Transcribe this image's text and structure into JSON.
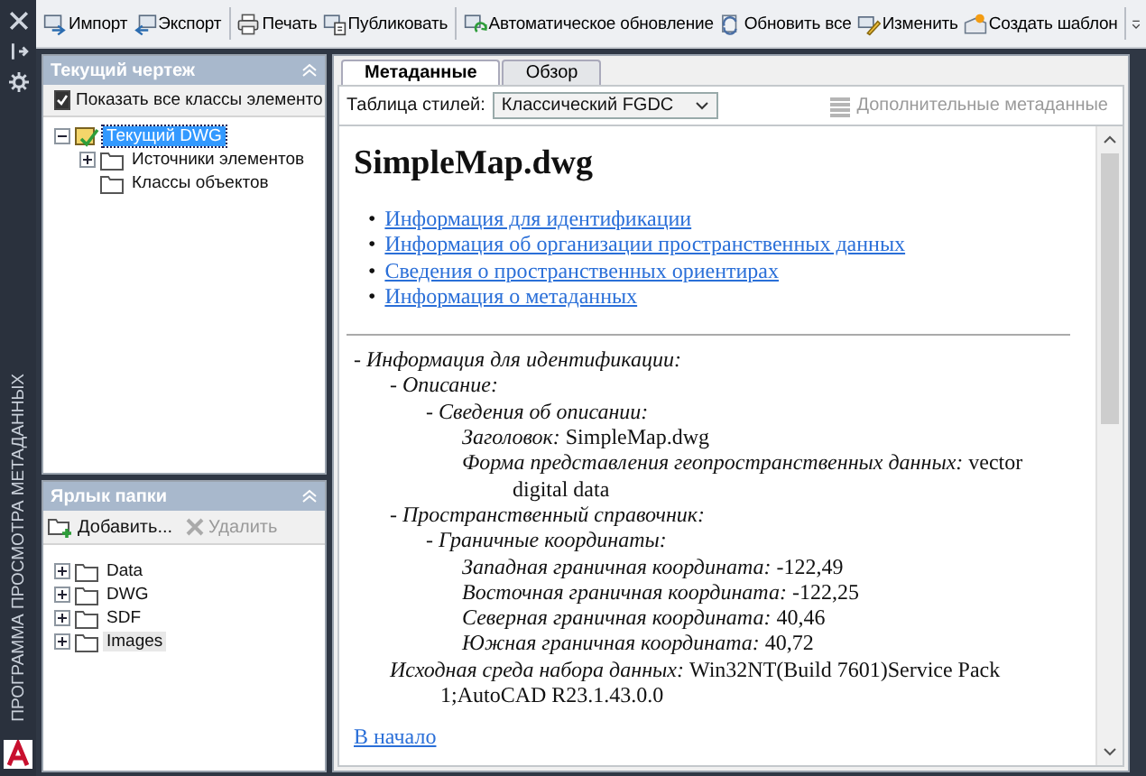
{
  "app": {
    "vertical_title": "ПРОГРАММА ПРОСМОТРА МЕТАДАННЫХ"
  },
  "toolbar": [
    {
      "label": "Импорт",
      "kind": "import"
    },
    {
      "label": "Экспорт",
      "kind": "export"
    },
    {
      "kind": "separator"
    },
    {
      "label": "Печать",
      "kind": "print"
    },
    {
      "label": "Публиковать",
      "kind": "publish"
    },
    {
      "kind": "separator"
    },
    {
      "label": "Автоматическое обновление",
      "kind": "auto_update"
    },
    {
      "label": "Обновить все",
      "kind": "refresh"
    },
    {
      "label": "Изменить",
      "kind": "edit"
    },
    {
      "label": "Создать шаблон",
      "kind": "template"
    },
    {
      "kind": "separator"
    }
  ],
  "current_drawing": {
    "title": "Текущий чертеж",
    "show_all_checkbox": {
      "label": "Показать все классы элементо",
      "checked": true
    },
    "tree": [
      {
        "label": "Текущий DWG",
        "expanded": true,
        "selected": true,
        "kind": "drawing",
        "children": [
          {
            "label": "Источники элементов",
            "expanded": false,
            "selected": false,
            "kind": "folder"
          },
          {
            "label": "Классы объектов",
            "selected": false,
            "kind": "folder"
          }
        ]
      }
    ]
  },
  "folder_shortcuts": {
    "title": "Ярлык папки",
    "add_button": {
      "label": "Добавить...",
      "disabled": false
    },
    "delete_button": {
      "label": "Удалить",
      "disabled": true
    },
    "items": [
      {
        "label": "Data",
        "expanded": false,
        "selected": false
      },
      {
        "label": "DWG",
        "expanded": false,
        "selected": false
      },
      {
        "label": "SDF",
        "expanded": false,
        "selected": false
      },
      {
        "label": "Images",
        "expanded": false,
        "selected": true
      }
    ]
  },
  "tabs": [
    {
      "label": "Метаданные",
      "selected": true
    },
    {
      "label": "Обзор",
      "selected": false
    }
  ],
  "stylesheet": {
    "label": "Таблица стилей:",
    "value": "Классический FGDC"
  },
  "extra_metadata_button": {
    "label": "Дополнительные метаданные",
    "disabled": true
  },
  "document": {
    "title": "SimpleMap.dwg",
    "links": [
      {
        "bullet": "•",
        "text": "Информация для идентификации"
      },
      {
        "bullet": "•",
        "text": "Информация об организации пространственных данных"
      },
      {
        "bullet": "•",
        "text": "Сведения о пространственных ориентирах"
      },
      {
        "bullet": "•",
        "text": "Информация о метаданных"
      }
    ],
    "details": [
      {
        "label": "- Информация для идентификации:",
        "children": [
          {
            "label": "- Описание:",
            "children": [
              {
                "label": "- Сведения об описании:",
                "children": [
                  {
                    "label": "Заголовок:",
                    "value": "SimpleMap.dwg"
                  },
                  {
                    "label": "Форма представления геопространственных данных:",
                    "value": "vector digital data"
                  }
                ]
              }
            ]
          },
          {
            "label": "- Пространственный справочник:",
            "children": [
              {
                "label": "- Граничные координаты:",
                "children": [
                  {
                    "label": "Западная граничная координата:",
                    "value": "-122,49"
                  },
                  {
                    "label": "Восточная граничная координата:",
                    "value": "-122,25"
                  },
                  {
                    "label": "Северная граничная координата:",
                    "value": "40,46"
                  },
                  {
                    "label": "Южная граничная координата:",
                    "value": "40,72"
                  }
                ]
              }
            ]
          },
          {
            "label": "Исходная среда набора данных:",
            "value": "Win32NT(Build 7601)Service Pack 1;AutoCAD R23.1.43.0.0"
          }
        ]
      }
    ],
    "back_link": "В начало"
  }
}
